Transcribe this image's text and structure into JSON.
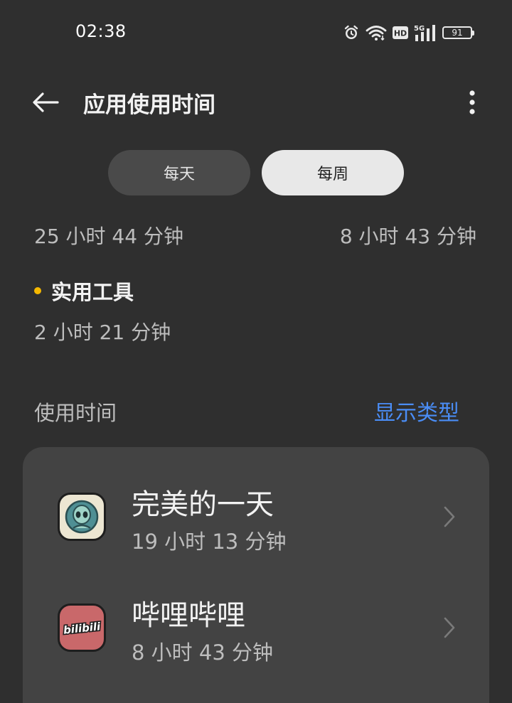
{
  "status_bar": {
    "time": "02:38",
    "icons": [
      "alarm-icon",
      "wifi-icon",
      "hd-icon",
      "5g-signal-icon",
      "battery-icon"
    ],
    "hd_label": "HD",
    "network_label": "5G",
    "battery_level": "91"
  },
  "header": {
    "title": "应用使用时间",
    "back_icon": "arrow-left-icon",
    "more_icon": "more-vertical-icon"
  },
  "segmented": {
    "daily_label": "每天",
    "weekly_label": "每周",
    "selected": "weekly"
  },
  "totals": {
    "left": "25 小时 44 分钟",
    "right": "8 小时 43 分钟"
  },
  "category": {
    "name": "实用工具",
    "time": "2 小时 21 分钟",
    "color": "#f5b800"
  },
  "section": {
    "title": "使用时间",
    "action_label": "显示类型",
    "action_color": "#4a8df6"
  },
  "apps": [
    {
      "name": "完美的一天",
      "time": "19 小时 13 分钟",
      "icon": "alien-app-icon"
    },
    {
      "name": "哔哩哔哩",
      "time": "8 小时 43 分钟",
      "icon": "bilibili-app-icon",
      "icon_text": "bilibili"
    }
  ]
}
